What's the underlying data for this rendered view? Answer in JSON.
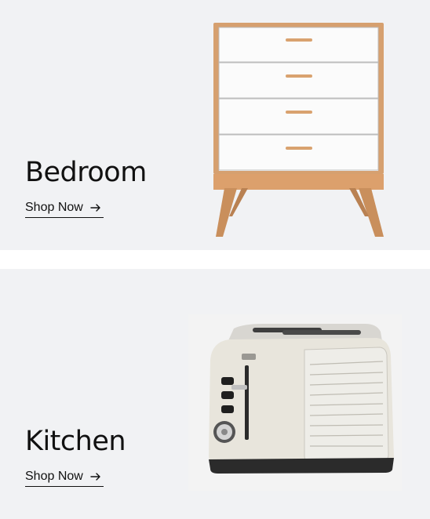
{
  "sections": [
    {
      "title": "Bedroom",
      "link_label": "Shop Now",
      "image_icon": "dresser-image",
      "background": "#f1f2f4"
    },
    {
      "title": "Kitchen",
      "link_label": "Shop Now",
      "image_icon": "toaster-image",
      "background": "#f1f2f4"
    }
  ],
  "colors": {
    "text": "#111111",
    "card_background": "#f1f2f4",
    "page_background": "#ffffff"
  }
}
